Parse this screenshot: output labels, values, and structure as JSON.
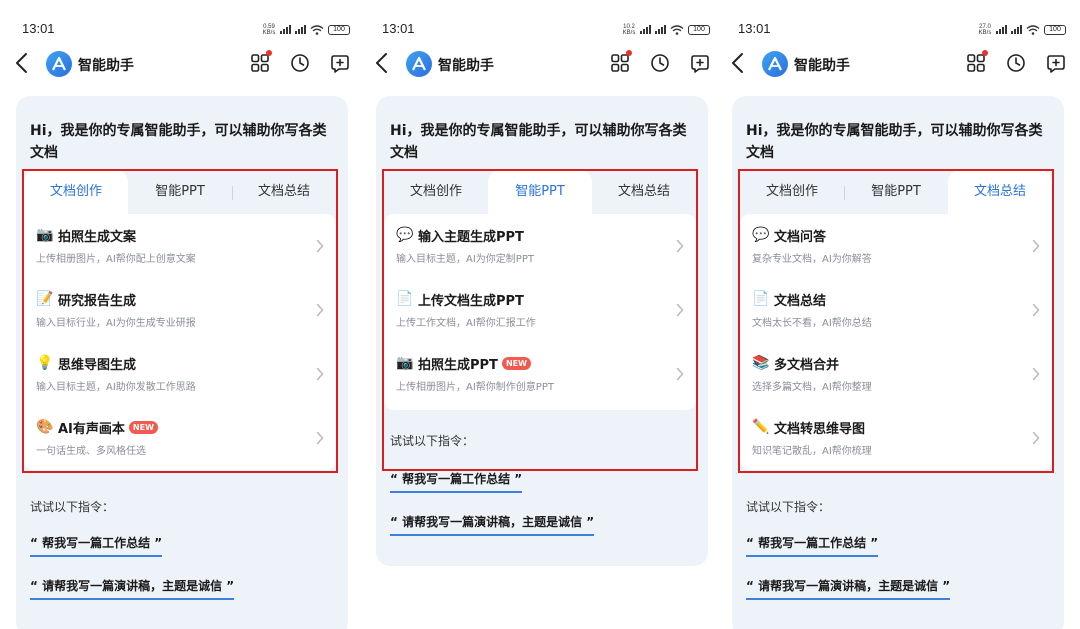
{
  "panels": [
    {
      "status": {
        "time": "13:01",
        "netspeed": "0.59",
        "netspeed_unit": "KB/s",
        "battery": "100"
      },
      "nav": {
        "title": "智能助手"
      },
      "greeting": "Hi，我是你的专属智能助手，可以辅助你写各类文档",
      "tabs": [
        "文档创作",
        "智能PPT",
        "文档总结"
      ],
      "active_tab": 0,
      "items": [
        {
          "icon": "camera-icon",
          "emoji": "📷",
          "title": "拍照生成文案",
          "sub": "上传相册图片，AI帮你配上创意文案",
          "badge": ""
        },
        {
          "icon": "memo-icon",
          "emoji": "📝",
          "title": "研究报告生成",
          "sub": "输入目标行业，AI为你生成专业研报",
          "badge": ""
        },
        {
          "icon": "lightbulb-icon",
          "emoji": "💡",
          "title": "思维导图生成",
          "sub": "输入目标主题，AI助你发散工作思路",
          "badge": ""
        },
        {
          "icon": "palette-icon",
          "emoji": "🎨",
          "title": "AI有声画本",
          "sub": "一句话生成、多风格任选",
          "badge": "NEW"
        }
      ],
      "prompts_heading": "试试以下指令：",
      "prompts": [
        "“ 帮我写一篇工作总结 ”",
        "“ 请帮我写一篇演讲稿，主题是诚信 ”"
      ]
    },
    {
      "status": {
        "time": "13:01",
        "netspeed": "10.2",
        "netspeed_unit": "KB/s",
        "battery": "100"
      },
      "nav": {
        "title": "智能助手"
      },
      "greeting": "Hi，我是你的专属智能助手，可以辅助你写各类文档",
      "tabs": [
        "文档创作",
        "智能PPT",
        "文档总结"
      ],
      "active_tab": 1,
      "items": [
        {
          "icon": "speech-bubble-icon",
          "emoji": "💬",
          "title": "输入主题生成PPT",
          "sub": "输入目标主题，AI为你定制PPT",
          "badge": ""
        },
        {
          "icon": "document-icon",
          "emoji": "📄",
          "title": "上传文档生成PPT",
          "sub": "上传工作文档，AI帮你汇报工作",
          "badge": ""
        },
        {
          "icon": "camera-icon",
          "emoji": "📷",
          "title": "拍照生成PPT",
          "sub": "上传相册图片，AI帮你制作创意PPT",
          "badge": "NEW"
        }
      ],
      "prompts_heading": "试试以下指令：",
      "prompts": [
        "“ 帮我写一篇工作总结 ”",
        "“ 请帮我写一篇演讲稿，主题是诚信 ”"
      ]
    },
    {
      "status": {
        "time": "13:01",
        "netspeed": "27.0",
        "netspeed_unit": "KB/s",
        "battery": "100"
      },
      "nav": {
        "title": "智能助手"
      },
      "greeting": "Hi，我是你的专属智能助手，可以辅助你写各类文档",
      "tabs": [
        "文档创作",
        "智能PPT",
        "文档总结"
      ],
      "active_tab": 2,
      "items": [
        {
          "icon": "speech-bubble-icon",
          "emoji": "💬",
          "title": "文档问答",
          "sub": "复杂专业文档，AI为你解答",
          "badge": ""
        },
        {
          "icon": "document-icon",
          "emoji": "📄",
          "title": "文档总结",
          "sub": "文档太长不看，AI帮你总结",
          "badge": ""
        },
        {
          "icon": "books-icon",
          "emoji": "📚",
          "title": "多文档合并",
          "sub": "选择多篇文档，AI帮你整理",
          "badge": ""
        },
        {
          "icon": "pencil-icon",
          "emoji": "✏️",
          "title": "文档转思维导图",
          "sub": "知识笔记散乱，AI帮你梳理",
          "badge": ""
        }
      ],
      "prompts_heading": "试试以下指令：",
      "prompts": [
        "“ 帮我写一篇工作总结 ”",
        "“ 请帮我写一篇演讲稿，主题是诚信 ”"
      ]
    }
  ],
  "colors": {
    "accent": "#2a74d8",
    "highlight_box": "#d82020",
    "card_bg": "#eef2f9",
    "badge": "#f05a4f"
  }
}
